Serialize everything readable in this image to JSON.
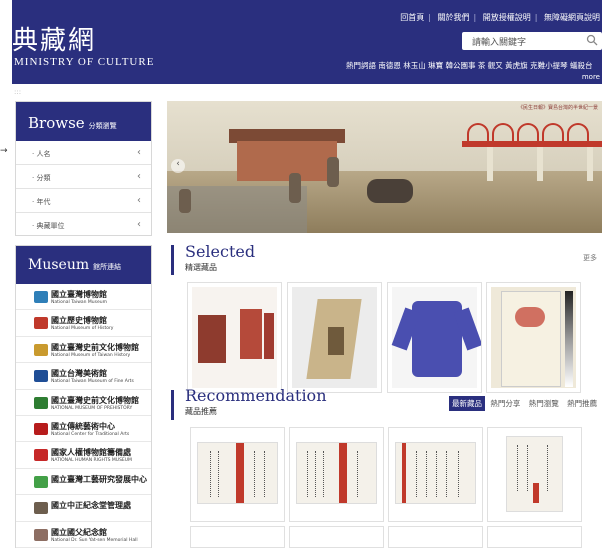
{
  "header": {
    "logo_cn": "典藏網",
    "logo_en": "MINISTRY OF CULTURE",
    "top_links": [
      "回首頁",
      "關於我們",
      "開放授權說明",
      "無障礙網頁說明"
    ],
    "search_placeholder": "請輸入關鍵字",
    "hot_keywords": "熱門詞語 南德恩 林玉山 琳寶 韓公園事 茶 觀又 黃虎旗 克難小提琴 蟻殺台",
    "hot_more": "more"
  },
  "sidebar": {
    "browse_title": "Browse",
    "browse_sub": "分類瀏覽",
    "browse_items": [
      {
        "label": "· 人名"
      },
      {
        "label": "· 分類"
      },
      {
        "label": "· 年代"
      },
      {
        "label": "· 典藏單位"
      }
    ],
    "museum_title": "Museum",
    "museum_sub": "館所連結",
    "museums": [
      {
        "name": "國立臺灣博物館",
        "sub": "National Taiwan Museum",
        "color": "#2f7fb8"
      },
      {
        "name": "國立歷史博物館",
        "sub": "National Museum of History",
        "color": "#c0392b"
      },
      {
        "name": "國立臺灣史前文化博物館",
        "sub": "National Museum of Taiwan History",
        "color": "#c99a2e"
      },
      {
        "name": "國立台灣美術館",
        "sub": "National Taiwan Museum of Fine Arts",
        "color": "#1f4e96"
      },
      {
        "name": "國立臺灣史前文化博物館",
        "sub": "NATIONAL MUSEUM OF PREHISTORY",
        "color": "#2e7d32"
      },
      {
        "name": "國立傳統藝術中心",
        "sub": "National Center for Traditional Arts",
        "color": "#b71c1c"
      },
      {
        "name": "國家人權博物館籌備處",
        "sub": "NATIONAL HUMAN RIGHTS MUSEUM",
        "color": "#c62828"
      },
      {
        "name": "國立臺灣工藝研究發展中心",
        "sub": "",
        "color": "#43a047"
      },
      {
        "name": "國立中正紀念堂管理處",
        "sub": "",
        "color": "#6d5e4e"
      },
      {
        "name": "國立國父紀念館",
        "sub": "National Dr. Sun Yat-sen Memorial Hall",
        "color": "#8d6e63"
      }
    ]
  },
  "banner": {
    "caption": "《民生日報》寶島台灣的半世紀一景"
  },
  "selected": {
    "title": "Selected",
    "sub": "精選藏品",
    "more": "更多"
  },
  "recommendation": {
    "title": "Recommendation",
    "sub": "藏品推薦",
    "tabs": [
      "最新藏品",
      "熱門分享",
      "熱門瀏覽",
      "熱門推薦"
    ]
  },
  "colors": {
    "brand": "#2a2f7e",
    "accent_red": "#c0392b"
  }
}
